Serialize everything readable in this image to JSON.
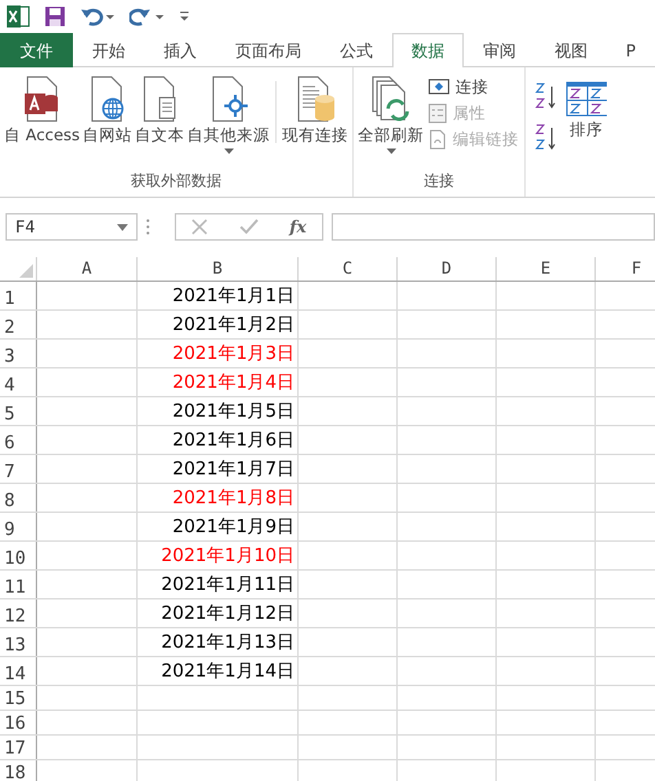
{
  "tabs": [
    {
      "label": "文件",
      "kind": "file",
      "selected": false
    },
    {
      "label": "开始",
      "kind": "tab",
      "selected": false
    },
    {
      "label": "插入",
      "kind": "tab",
      "selected": false
    },
    {
      "label": "页面布局",
      "kind": "tab",
      "selected": false
    },
    {
      "label": "公式",
      "kind": "tab",
      "selected": false
    },
    {
      "label": "数据",
      "kind": "tab",
      "selected": true
    },
    {
      "label": "审阅",
      "kind": "tab",
      "selected": false
    },
    {
      "label": "视图",
      "kind": "tab",
      "selected": false
    },
    {
      "label": "P",
      "kind": "tab",
      "selected": false
    }
  ],
  "ribbon": {
    "groups": [
      {
        "label": "获取外部数据",
        "buttons": [
          {
            "label": "自 Access",
            "kind": "access",
            "dropdown": false
          },
          {
            "label": "自网站",
            "kind": "web",
            "dropdown": false
          },
          {
            "label": "自文本",
            "kind": "text",
            "dropdown": false
          },
          {
            "label": "自其他来源",
            "kind": "other",
            "dropdown": true
          },
          {
            "label": "现有连接",
            "kind": "existing",
            "dropdown": false
          }
        ]
      },
      {
        "label": "连接",
        "buttons": [
          {
            "label": "全部刷新",
            "kind": "refresh",
            "dropdown": true
          }
        ],
        "small": [
          {
            "label": "连接",
            "disabled": false
          },
          {
            "label": "属性",
            "disabled": true
          },
          {
            "label": "编辑链接",
            "disabled": true
          }
        ]
      }
    ],
    "sort_label": "排序"
  },
  "formula_bar": {
    "name_box": "F4",
    "fx": "fx"
  },
  "columns": [
    "A",
    "B",
    "C",
    "D",
    "E",
    "F"
  ],
  "rows": [
    {
      "number": "1",
      "date": "2021年1月1日",
      "color": "#000000"
    },
    {
      "number": "2",
      "date": "2021年1月2日",
      "color": "#000000"
    },
    {
      "number": "3",
      "date": "2021年1月3日",
      "color": "#ff0000"
    },
    {
      "number": "4",
      "date": "2021年1月4日",
      "color": "#ff0000"
    },
    {
      "number": "5",
      "date": "2021年1月5日",
      "color": "#000000"
    },
    {
      "number": "6",
      "date": "2021年1月6日",
      "color": "#000000"
    },
    {
      "number": "7",
      "date": "2021年1月7日",
      "color": "#000000"
    },
    {
      "number": "8",
      "date": "2021年1月8日",
      "color": "#ff0000"
    },
    {
      "number": "9",
      "date": "2021年1月9日",
      "color": "#000000"
    },
    {
      "number": "10",
      "date": "2021年1月10日",
      "color": "#ff0000"
    },
    {
      "number": "11",
      "date": "2021年1月11日",
      "color": "#000000"
    },
    {
      "number": "12",
      "date": "2021年1月12日",
      "color": "#000000"
    },
    {
      "number": "13",
      "date": "2021年1月13日",
      "color": "#000000"
    },
    {
      "number": "14",
      "date": "2021年1月14日",
      "color": "#000000"
    },
    {
      "number": "15"
    },
    {
      "number": "16"
    },
    {
      "number": "17"
    },
    {
      "number": "18"
    }
  ]
}
